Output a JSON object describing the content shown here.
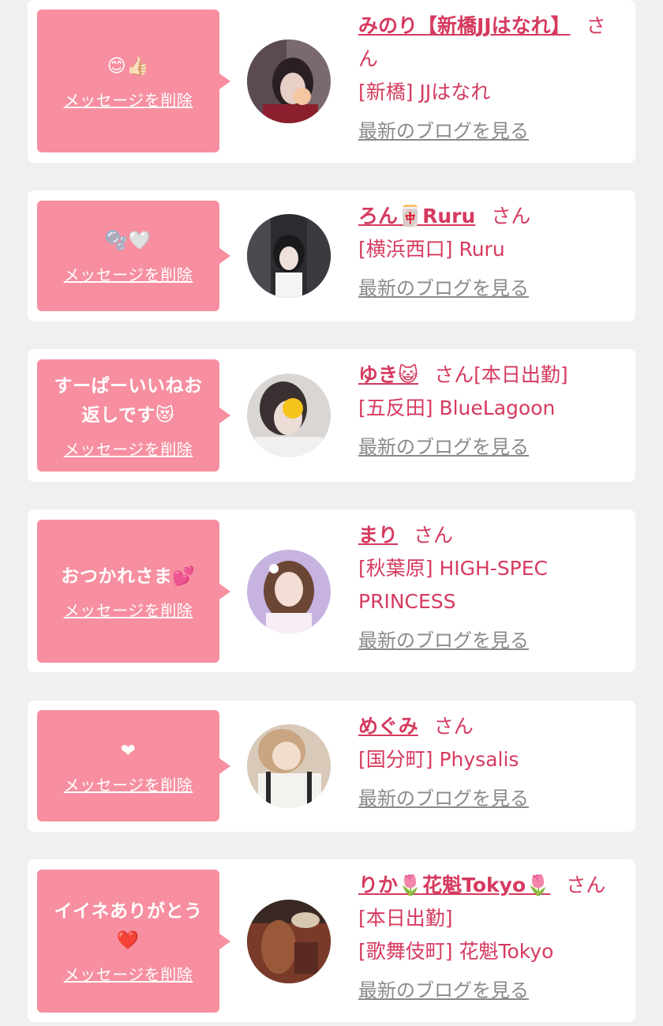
{
  "cards": [
    {
      "message": "😊👍🏻",
      "delete_label": "メッセージを削除",
      "name": "みのり【新橋JJはなれ】",
      "san_label": "さん",
      "status": "",
      "shop": "[新橋] JJはなれ",
      "blog_label": "最新のブログを見る"
    },
    {
      "message": "🫧🤍",
      "delete_label": "メッセージを削除",
      "name": "ろん🀄Ruru",
      "san_label": "さん",
      "status": "",
      "shop": "[横浜西口] Ruru",
      "blog_label": "最新のブログを見る"
    },
    {
      "message": "すーぱーいいねお返しです😻",
      "delete_label": "メッセージを削除",
      "name": "ゆき😺",
      "san_label": "さん",
      "status": "[本日出勤]",
      "shop": "[五反田] BlueLagoon",
      "blog_label": "最新のブログを見る"
    },
    {
      "message": "おつかれさま💕",
      "delete_label": "メッセージを削除",
      "name": "まり",
      "san_label": "さん",
      "status": "",
      "shop": "[秋葉原] HIGH-SPEC PRINCESS",
      "blog_label": "最新のブログを見る"
    },
    {
      "message": "❤",
      "delete_label": "メッセージを削除",
      "name": "めぐみ",
      "san_label": "さん",
      "status": "",
      "shop": "[国分町] Physalis",
      "blog_label": "最新のブログを見る"
    },
    {
      "message": "イイネありがとう❤️",
      "delete_label": "メッセージを削除",
      "name": "りか🌷花魁Tokyo🌷",
      "san_label": "さん",
      "status": "[本日出勤]",
      "shop": "[歌舞伎町] 花魁Tokyo",
      "blog_label": "最新のブログを見る"
    }
  ],
  "colors": {
    "bubble": "#f78fa0",
    "accent": "#d63a5f",
    "blog_link": "#8a8a8a",
    "background": "#f0f0f0"
  }
}
